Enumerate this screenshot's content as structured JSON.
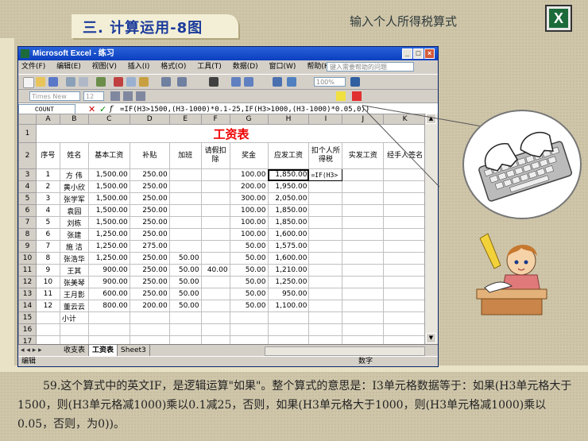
{
  "slide": {
    "title": "三. 计算运用-8图",
    "heading": "输入个人所得税算式",
    "logo_letter": "X"
  },
  "excel": {
    "window_title": "Microsoft Excel - 练习",
    "menu": [
      "文件(F)",
      "编辑(E)",
      "视图(V)",
      "插入(I)",
      "格式(O)",
      "工具(T)",
      "数据(D)",
      "窗口(W)",
      "帮助(H)"
    ],
    "help_placeholder": "键入需要帮助的问题",
    "zoom": "100%",
    "font_name": "Times New Roman",
    "font_size": "12",
    "name_box": "COUNT",
    "formula": "=IF(H3>1500,(H3-1000)*0.1-25,IF(H3>1000,(H3-1000)*0.05,0))",
    "columns": [
      "A",
      "B",
      "C",
      "D",
      "E",
      "F",
      "G",
      "H",
      "I",
      "J",
      "K"
    ],
    "sheet_title": "工资表",
    "headers": [
      "序号",
      "姓名",
      "基本工资",
      "补贴",
      "加班",
      "请假扣除",
      "奖金",
      "应发工资",
      "扣个人所得税",
      "实发工资",
      "经手人签名"
    ],
    "rows": [
      [
        "1",
        "方 伟",
        "1,500.00",
        "250.00",
        "",
        "",
        "100.00",
        "1,850.00",
        "=IF(H3>",
        "",
        ""
      ],
      [
        "2",
        "黄小欣",
        "1,500.00",
        "250.00",
        "",
        "",
        "200.00",
        "1,950.00",
        "",
        "",
        ""
      ],
      [
        "3",
        "张学军",
        "1,500.00",
        "250.00",
        "",
        "",
        "300.00",
        "2,050.00",
        "",
        "",
        ""
      ],
      [
        "4",
        "袁园",
        "1,500.00",
        "250.00",
        "",
        "",
        "100.00",
        "1,850.00",
        "",
        "",
        ""
      ],
      [
        "5",
        "刘栋",
        "1,500.00",
        "250.00",
        "",
        "",
        "100.00",
        "1,850.00",
        "",
        "",
        ""
      ],
      [
        "6",
        "张建",
        "1,250.00",
        "250.00",
        "",
        "",
        "100.00",
        "1,600.00",
        "",
        "",
        ""
      ],
      [
        "7",
        "施 洁",
        "1,250.00",
        "275.00",
        "",
        "",
        "50.00",
        "1,575.00",
        "",
        "",
        ""
      ],
      [
        "8",
        "张浩华",
        "1,250.00",
        "250.00",
        "50.00",
        "",
        "50.00",
        "1,600.00",
        "",
        "",
        ""
      ],
      [
        "9",
        "王其",
        "900.00",
        "250.00",
        "50.00",
        "40.00",
        "50.00",
        "1,210.00",
        "",
        "",
        ""
      ],
      [
        "10",
        "张美琴",
        "900.00",
        "250.00",
        "50.00",
        "",
        "50.00",
        "1,250.00",
        "",
        "",
        ""
      ],
      [
        "11",
        "王月影",
        "600.00",
        "250.00",
        "50.00",
        "",
        "50.00",
        "950.00",
        "",
        "",
        ""
      ],
      [
        "12",
        "董云云",
        "800.00",
        "200.00",
        "50.00",
        "",
        "50.00",
        "1,100.00",
        "",
        "",
        ""
      ]
    ],
    "subtotal_label": "小计",
    "sheet_tabs": [
      "收支表",
      "工资表",
      "Sheet3"
    ],
    "active_tab": "工资表",
    "status_left": "编辑",
    "status_right": "数字"
  },
  "caption": "59.这个算式中的英文IF，是逻辑运算\"如果\"。整个算式的意思是：I3单元格数据等于：如果(H3单元格大于1500，则(H3单元格减1000)乘以0.1减25，否则，如果(H3单元格大于1000，则(H3单元格减1000)乘以0.05，否则，为0))。"
}
